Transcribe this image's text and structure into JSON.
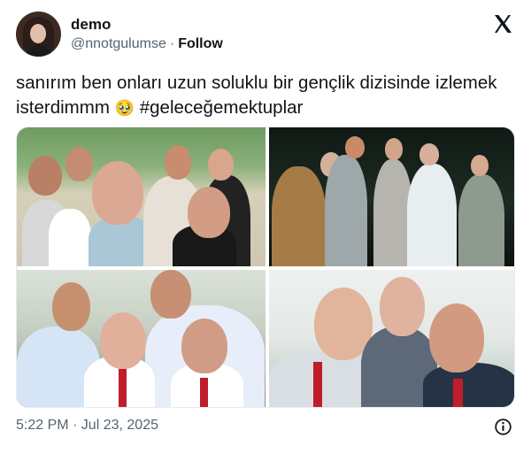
{
  "user": {
    "name": "demo",
    "handle": "@nnotgulumse",
    "follow_label": "Follow"
  },
  "tweet": {
    "text": "sanırım ben onları uzun soluklu bir gençlik dizisinde izlemek isterdimmm",
    "emoji": "🥹",
    "hashtag": "#geleceğemektuplar"
  },
  "footer": {
    "timestamp": "5:22 PM · Jul 23, 2025"
  },
  "icons": {
    "brand": "x-logo-icon",
    "info": "info-icon"
  },
  "colors": {
    "text": "#0f1419",
    "muted": "#536471"
  }
}
